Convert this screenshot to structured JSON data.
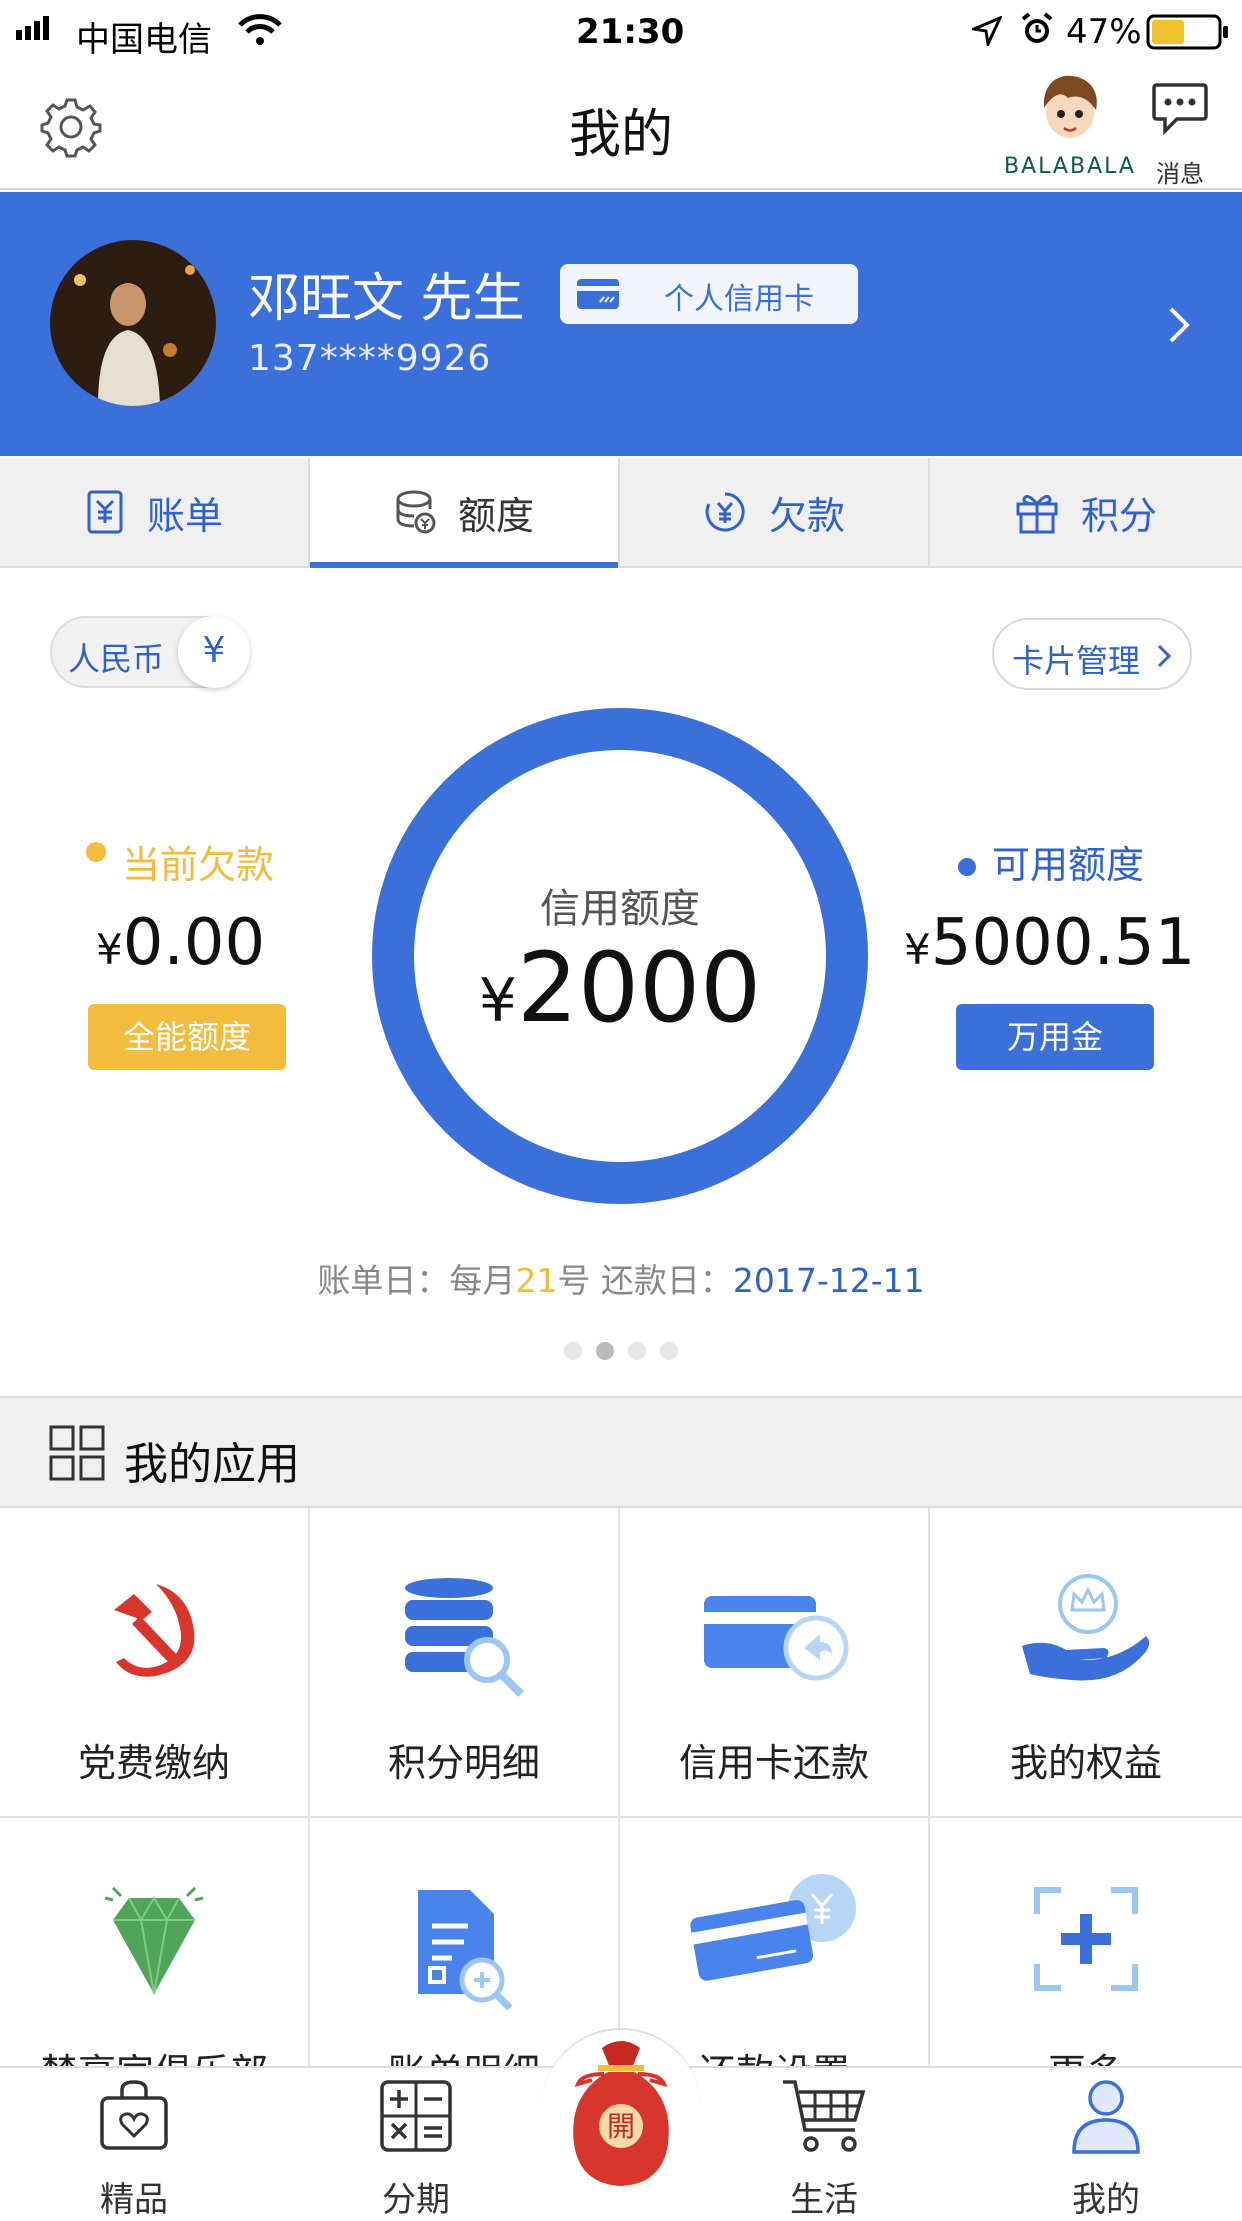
{
  "status_bar": {
    "carrier": "中国电信",
    "time": "21:30",
    "battery": "47%"
  },
  "header": {
    "title": "我的",
    "balabala_label": "BALABALA",
    "message_label": "消息"
  },
  "profile": {
    "name": "邓旺文 先生",
    "phone": "137****9926",
    "card_type": "个人信用卡"
  },
  "tabs": [
    {
      "label": "账单",
      "icon": "bill-icon"
    },
    {
      "label": "额度",
      "icon": "coins-icon"
    },
    {
      "label": "欠款",
      "icon": "yen-circle-icon"
    },
    {
      "label": "积分",
      "icon": "gift-icon"
    }
  ],
  "credit": {
    "currency_label": "人民币",
    "currency_symbol": "¥",
    "card_manage": "卡片管理",
    "current_debt_label": "当前欠款",
    "current_debt_value": "0.00",
    "all_purpose_button": "全能额度",
    "credit_limit_label": "信用额度",
    "credit_limit_value": "2000",
    "available_label": "可用额度",
    "available_value": "5000.51",
    "wanyongjin_button": "万用金",
    "bill_day_prefix": "账单日：每月",
    "bill_day_num": "21",
    "bill_day_suffix": "号 还款日：",
    "repay_date": "2017-12-11",
    "page_dots_active": 2,
    "page_dots_total": 4,
    "colors": {
      "primary": "#3b6fd9",
      "accent": "#f2bc3e"
    }
  },
  "apps": {
    "title": "我的应用",
    "items": [
      {
        "label": "党费缴纳",
        "icon": "hammer-sickle-icon"
      },
      {
        "label": "积分明细",
        "icon": "database-search-icon"
      },
      {
        "label": "信用卡还款",
        "icon": "card-repay-icon"
      },
      {
        "label": "我的权益",
        "icon": "crown-hand-icon"
      },
      {
        "label": "禁亭家俱乐部",
        "icon": "diamond-icon"
      },
      {
        "label": "账单明细",
        "icon": "document-search-icon"
      },
      {
        "label": "还款设置",
        "icon": "card-yen-icon"
      },
      {
        "label": "更多",
        "icon": "plus-frame-icon"
      }
    ]
  },
  "tabbar": {
    "items": [
      {
        "label": "精品",
        "icon": "bag-heart-icon"
      },
      {
        "label": "分期",
        "icon": "calculator-icon"
      },
      {
        "label": "開",
        "icon": "lucky-bag-icon"
      },
      {
        "label": "生活",
        "icon": "cart-icon"
      },
      {
        "label": "我的",
        "icon": "person-icon"
      }
    ]
  }
}
